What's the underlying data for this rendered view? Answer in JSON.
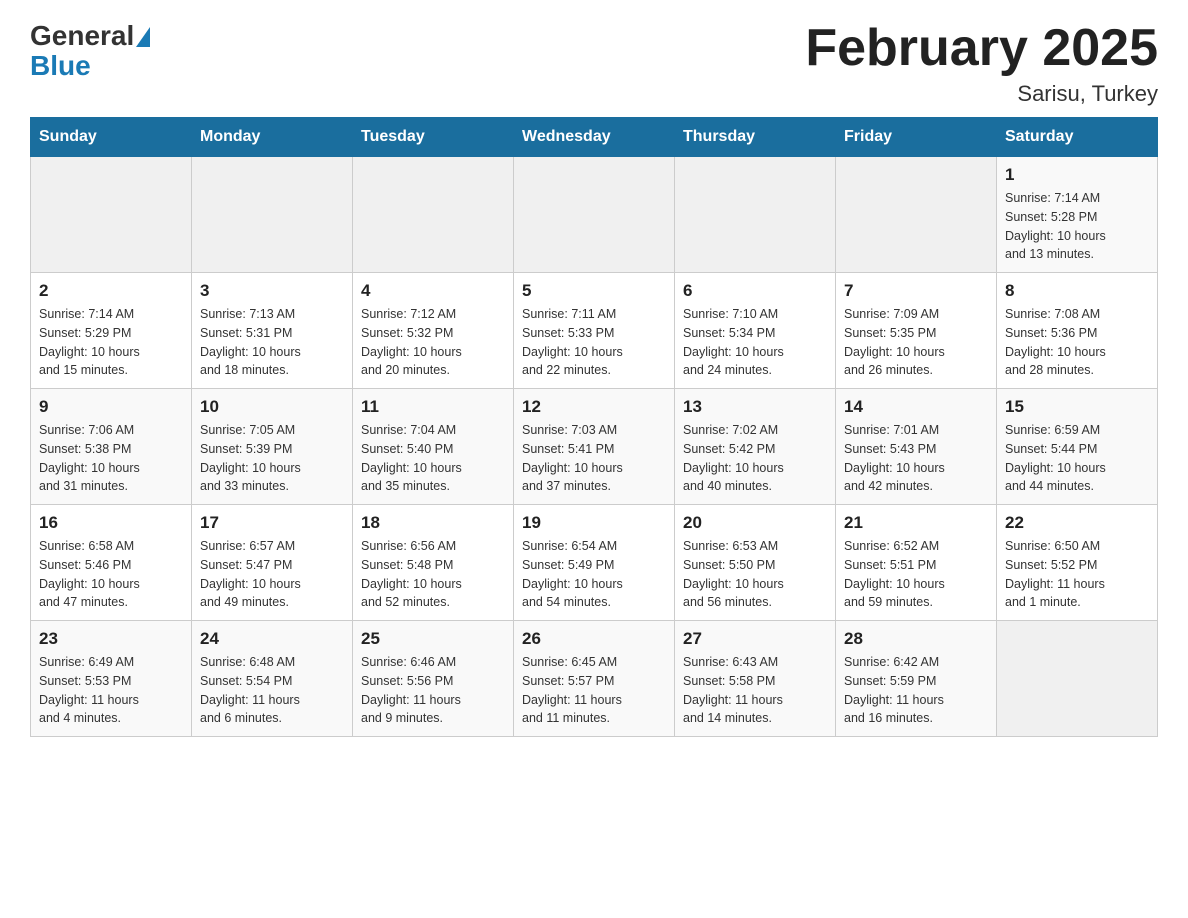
{
  "logo": {
    "text_general": "General",
    "text_blue": "Blue"
  },
  "header": {
    "title": "February 2025",
    "location": "Sarisu, Turkey"
  },
  "weekdays": [
    "Sunday",
    "Monday",
    "Tuesday",
    "Wednesday",
    "Thursday",
    "Friday",
    "Saturday"
  ],
  "weeks": [
    [
      {
        "day": "",
        "info": ""
      },
      {
        "day": "",
        "info": ""
      },
      {
        "day": "",
        "info": ""
      },
      {
        "day": "",
        "info": ""
      },
      {
        "day": "",
        "info": ""
      },
      {
        "day": "",
        "info": ""
      },
      {
        "day": "1",
        "info": "Sunrise: 7:14 AM\nSunset: 5:28 PM\nDaylight: 10 hours\nand 13 minutes."
      }
    ],
    [
      {
        "day": "2",
        "info": "Sunrise: 7:14 AM\nSunset: 5:29 PM\nDaylight: 10 hours\nand 15 minutes."
      },
      {
        "day": "3",
        "info": "Sunrise: 7:13 AM\nSunset: 5:31 PM\nDaylight: 10 hours\nand 18 minutes."
      },
      {
        "day": "4",
        "info": "Sunrise: 7:12 AM\nSunset: 5:32 PM\nDaylight: 10 hours\nand 20 minutes."
      },
      {
        "day": "5",
        "info": "Sunrise: 7:11 AM\nSunset: 5:33 PM\nDaylight: 10 hours\nand 22 minutes."
      },
      {
        "day": "6",
        "info": "Sunrise: 7:10 AM\nSunset: 5:34 PM\nDaylight: 10 hours\nand 24 minutes."
      },
      {
        "day": "7",
        "info": "Sunrise: 7:09 AM\nSunset: 5:35 PM\nDaylight: 10 hours\nand 26 minutes."
      },
      {
        "day": "8",
        "info": "Sunrise: 7:08 AM\nSunset: 5:36 PM\nDaylight: 10 hours\nand 28 minutes."
      }
    ],
    [
      {
        "day": "9",
        "info": "Sunrise: 7:06 AM\nSunset: 5:38 PM\nDaylight: 10 hours\nand 31 minutes."
      },
      {
        "day": "10",
        "info": "Sunrise: 7:05 AM\nSunset: 5:39 PM\nDaylight: 10 hours\nand 33 minutes."
      },
      {
        "day": "11",
        "info": "Sunrise: 7:04 AM\nSunset: 5:40 PM\nDaylight: 10 hours\nand 35 minutes."
      },
      {
        "day": "12",
        "info": "Sunrise: 7:03 AM\nSunset: 5:41 PM\nDaylight: 10 hours\nand 37 minutes."
      },
      {
        "day": "13",
        "info": "Sunrise: 7:02 AM\nSunset: 5:42 PM\nDaylight: 10 hours\nand 40 minutes."
      },
      {
        "day": "14",
        "info": "Sunrise: 7:01 AM\nSunset: 5:43 PM\nDaylight: 10 hours\nand 42 minutes."
      },
      {
        "day": "15",
        "info": "Sunrise: 6:59 AM\nSunset: 5:44 PM\nDaylight: 10 hours\nand 44 minutes."
      }
    ],
    [
      {
        "day": "16",
        "info": "Sunrise: 6:58 AM\nSunset: 5:46 PM\nDaylight: 10 hours\nand 47 minutes."
      },
      {
        "day": "17",
        "info": "Sunrise: 6:57 AM\nSunset: 5:47 PM\nDaylight: 10 hours\nand 49 minutes."
      },
      {
        "day": "18",
        "info": "Sunrise: 6:56 AM\nSunset: 5:48 PM\nDaylight: 10 hours\nand 52 minutes."
      },
      {
        "day": "19",
        "info": "Sunrise: 6:54 AM\nSunset: 5:49 PM\nDaylight: 10 hours\nand 54 minutes."
      },
      {
        "day": "20",
        "info": "Sunrise: 6:53 AM\nSunset: 5:50 PM\nDaylight: 10 hours\nand 56 minutes."
      },
      {
        "day": "21",
        "info": "Sunrise: 6:52 AM\nSunset: 5:51 PM\nDaylight: 10 hours\nand 59 minutes."
      },
      {
        "day": "22",
        "info": "Sunrise: 6:50 AM\nSunset: 5:52 PM\nDaylight: 11 hours\nand 1 minute."
      }
    ],
    [
      {
        "day": "23",
        "info": "Sunrise: 6:49 AM\nSunset: 5:53 PM\nDaylight: 11 hours\nand 4 minutes."
      },
      {
        "day": "24",
        "info": "Sunrise: 6:48 AM\nSunset: 5:54 PM\nDaylight: 11 hours\nand 6 minutes."
      },
      {
        "day": "25",
        "info": "Sunrise: 6:46 AM\nSunset: 5:56 PM\nDaylight: 11 hours\nand 9 minutes."
      },
      {
        "day": "26",
        "info": "Sunrise: 6:45 AM\nSunset: 5:57 PM\nDaylight: 11 hours\nand 11 minutes."
      },
      {
        "day": "27",
        "info": "Sunrise: 6:43 AM\nSunset: 5:58 PM\nDaylight: 11 hours\nand 14 minutes."
      },
      {
        "day": "28",
        "info": "Sunrise: 6:42 AM\nSunset: 5:59 PM\nDaylight: 11 hours\nand 16 minutes."
      },
      {
        "day": "",
        "info": ""
      }
    ]
  ]
}
